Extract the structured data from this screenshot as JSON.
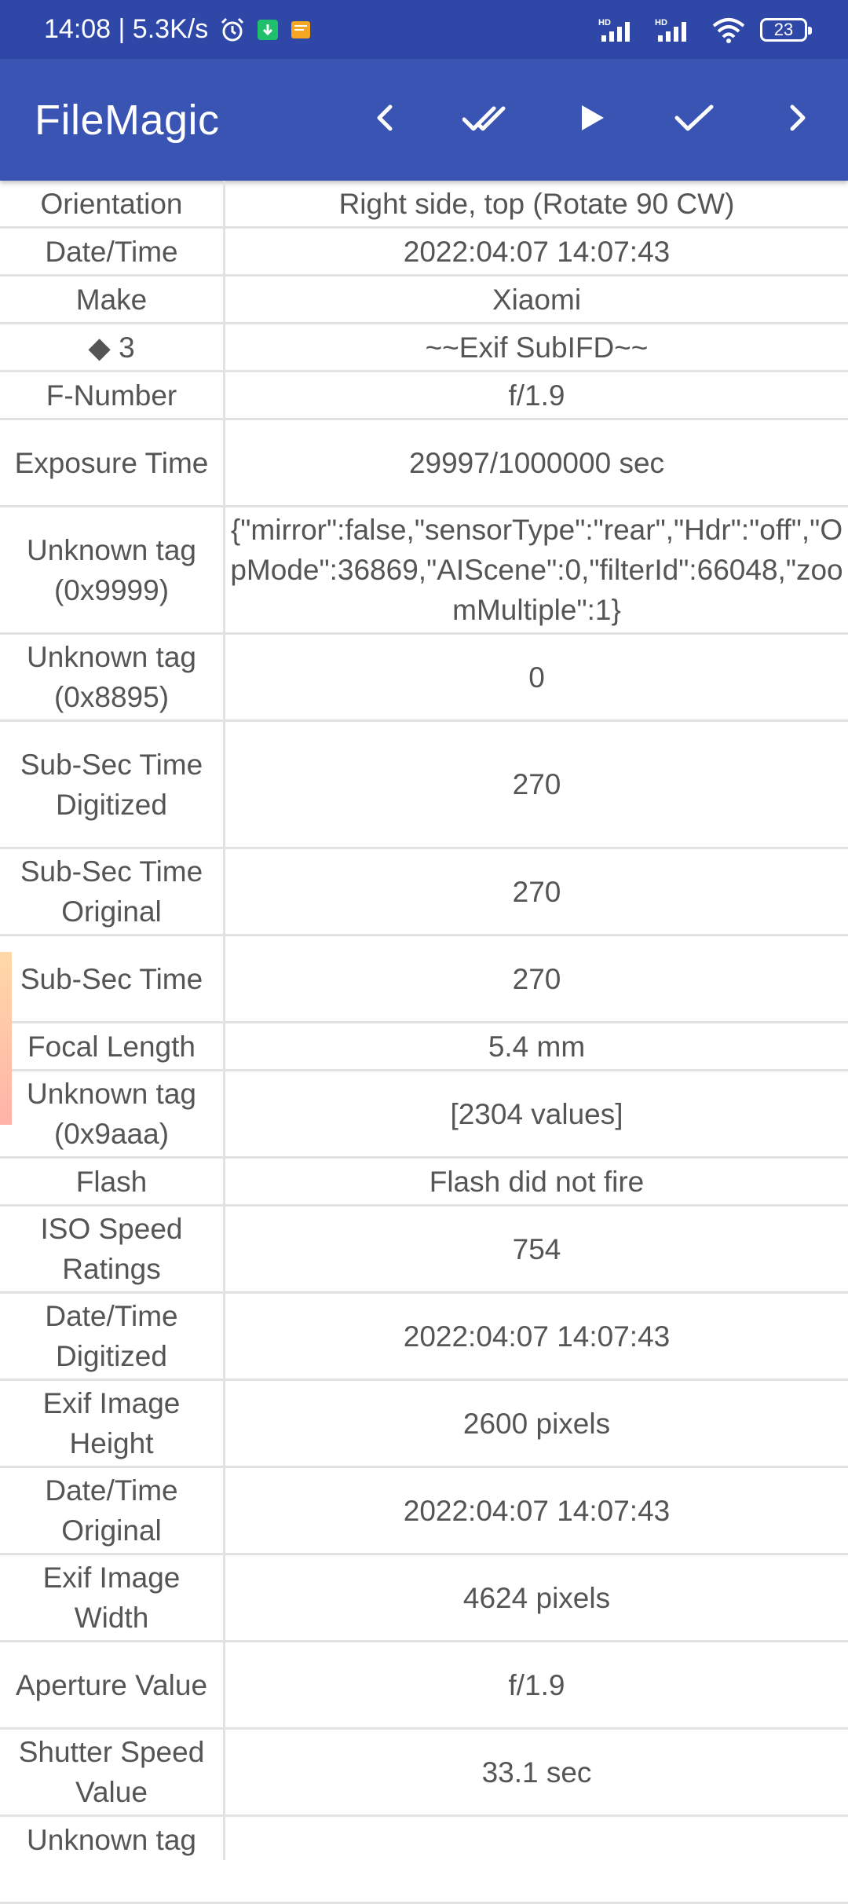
{
  "status_bar": {
    "time_speed": "14:08 | 5.3K/s",
    "battery": "23",
    "signal_label": "HD"
  },
  "app_bar": {
    "title": "FileMagic",
    "actions": [
      {
        "icon": "chevron-left-icon"
      },
      {
        "icon": "double-check-icon"
      },
      {
        "icon": "play-icon"
      },
      {
        "icon": "check-icon"
      },
      {
        "icon": "chevron-right-icon"
      }
    ]
  },
  "rows": [
    {
      "label": "Orientation",
      "value": "Right side, top (Rotate 90 CW)"
    },
    {
      "label": "Date/Time",
      "value": "2022:04:07 14:07:43"
    },
    {
      "label": "Make",
      "value": "Xiaomi"
    },
    {
      "label": "◆ 3",
      "value": "~~Exif SubIFD~~"
    },
    {
      "label": "F-Number",
      "value": "f/1.9"
    },
    {
      "label": "Exposure Time",
      "value": "29997/1000000 sec"
    },
    {
      "label": "Unknown tag (0x9999)",
      "value": "{\"mirror\":false,\"sensorType\":\"rear\",\"Hdr\":\"off\",\"OpMode\":36869,\"AIScene\":0,\"filterId\":66048,\"zoomMultiple\":1}"
    },
    {
      "label": "Unknown tag (0x8895)",
      "value": "0"
    },
    {
      "label": "Sub-Sec Time Digitized",
      "value": "270"
    },
    {
      "label": "Sub-Sec Time Original",
      "value": "270"
    },
    {
      "label": "Sub-Sec Time",
      "value": "270"
    },
    {
      "label": "Focal Length",
      "value": "5.4 mm"
    },
    {
      "label": "Unknown tag (0x9aaa)",
      "value": "[2304 values]"
    },
    {
      "label": "Flash",
      "value": "Flash did not fire"
    },
    {
      "label": "ISO Speed Ratings",
      "value": "754"
    },
    {
      "label": "Date/Time Digitized",
      "value": "2022:04:07 14:07:43"
    },
    {
      "label": "Exif Image Height",
      "value": "2600 pixels"
    },
    {
      "label": "Date/Time Original",
      "value": "2022:04:07 14:07:43"
    },
    {
      "label": "Exif Image Width",
      "value": "4624 pixels"
    },
    {
      "label": "Aperture Value",
      "value": "f/1.9"
    },
    {
      "label": "Shutter Speed Value",
      "value": "33.1 sec"
    },
    {
      "label": "Unknown tag",
      "value": ""
    }
  ],
  "colors": {
    "status_bar_bg": "#2f48a8",
    "app_bar_bg": "#3a54b4",
    "text": "#555555",
    "grid": "#e2e2e2"
  }
}
